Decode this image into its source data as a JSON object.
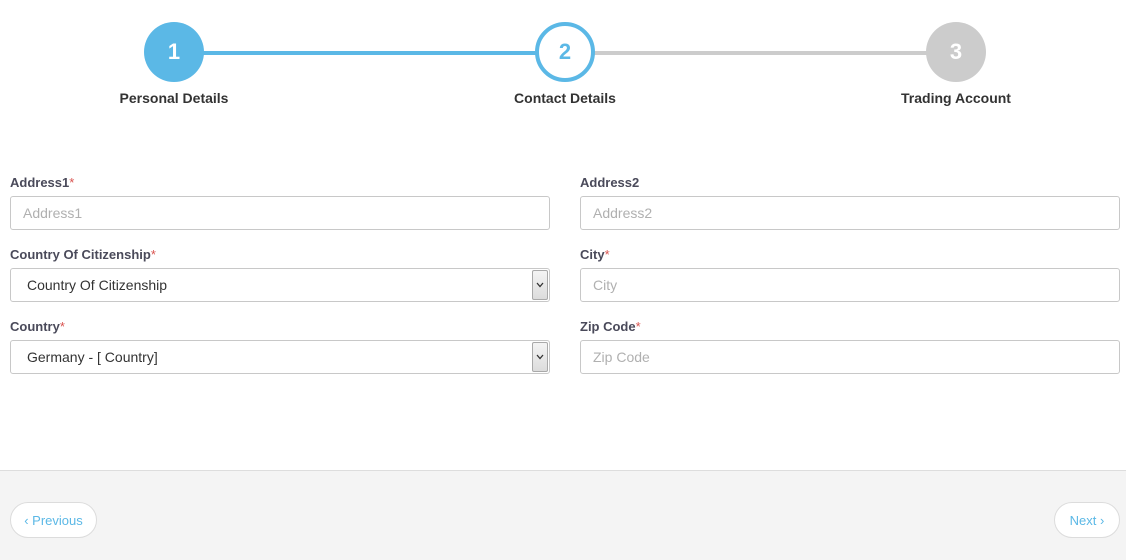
{
  "colors": {
    "accent": "#5bb8e6",
    "pending": "#cccccc",
    "required": "#d9534f"
  },
  "stepper": {
    "steps": [
      {
        "number": "1",
        "label": "Personal Details",
        "state": "completed"
      },
      {
        "number": "2",
        "label": "Contact Details",
        "state": "active"
      },
      {
        "number": "3",
        "label": "Trading Account",
        "state": "pending"
      }
    ]
  },
  "form": {
    "address1": {
      "label": "Address1",
      "required_mark": "*",
      "placeholder": "Address1",
      "value": ""
    },
    "address2": {
      "label": "Address2",
      "placeholder": "Address2",
      "value": ""
    },
    "citizenship": {
      "label": "Country Of Citizenship",
      "required_mark": "*",
      "selected": "Country Of Citizenship"
    },
    "city": {
      "label": "City",
      "required_mark": "*",
      "placeholder": "City",
      "value": ""
    },
    "country": {
      "label": "Country",
      "required_mark": "*",
      "selected": "Germany - [ Country]"
    },
    "zip": {
      "label": "Zip Code",
      "required_mark": "*",
      "placeholder": "Zip Code",
      "value": ""
    }
  },
  "footer": {
    "previous_label": "‹ Previous",
    "next_label": "Next ›"
  }
}
